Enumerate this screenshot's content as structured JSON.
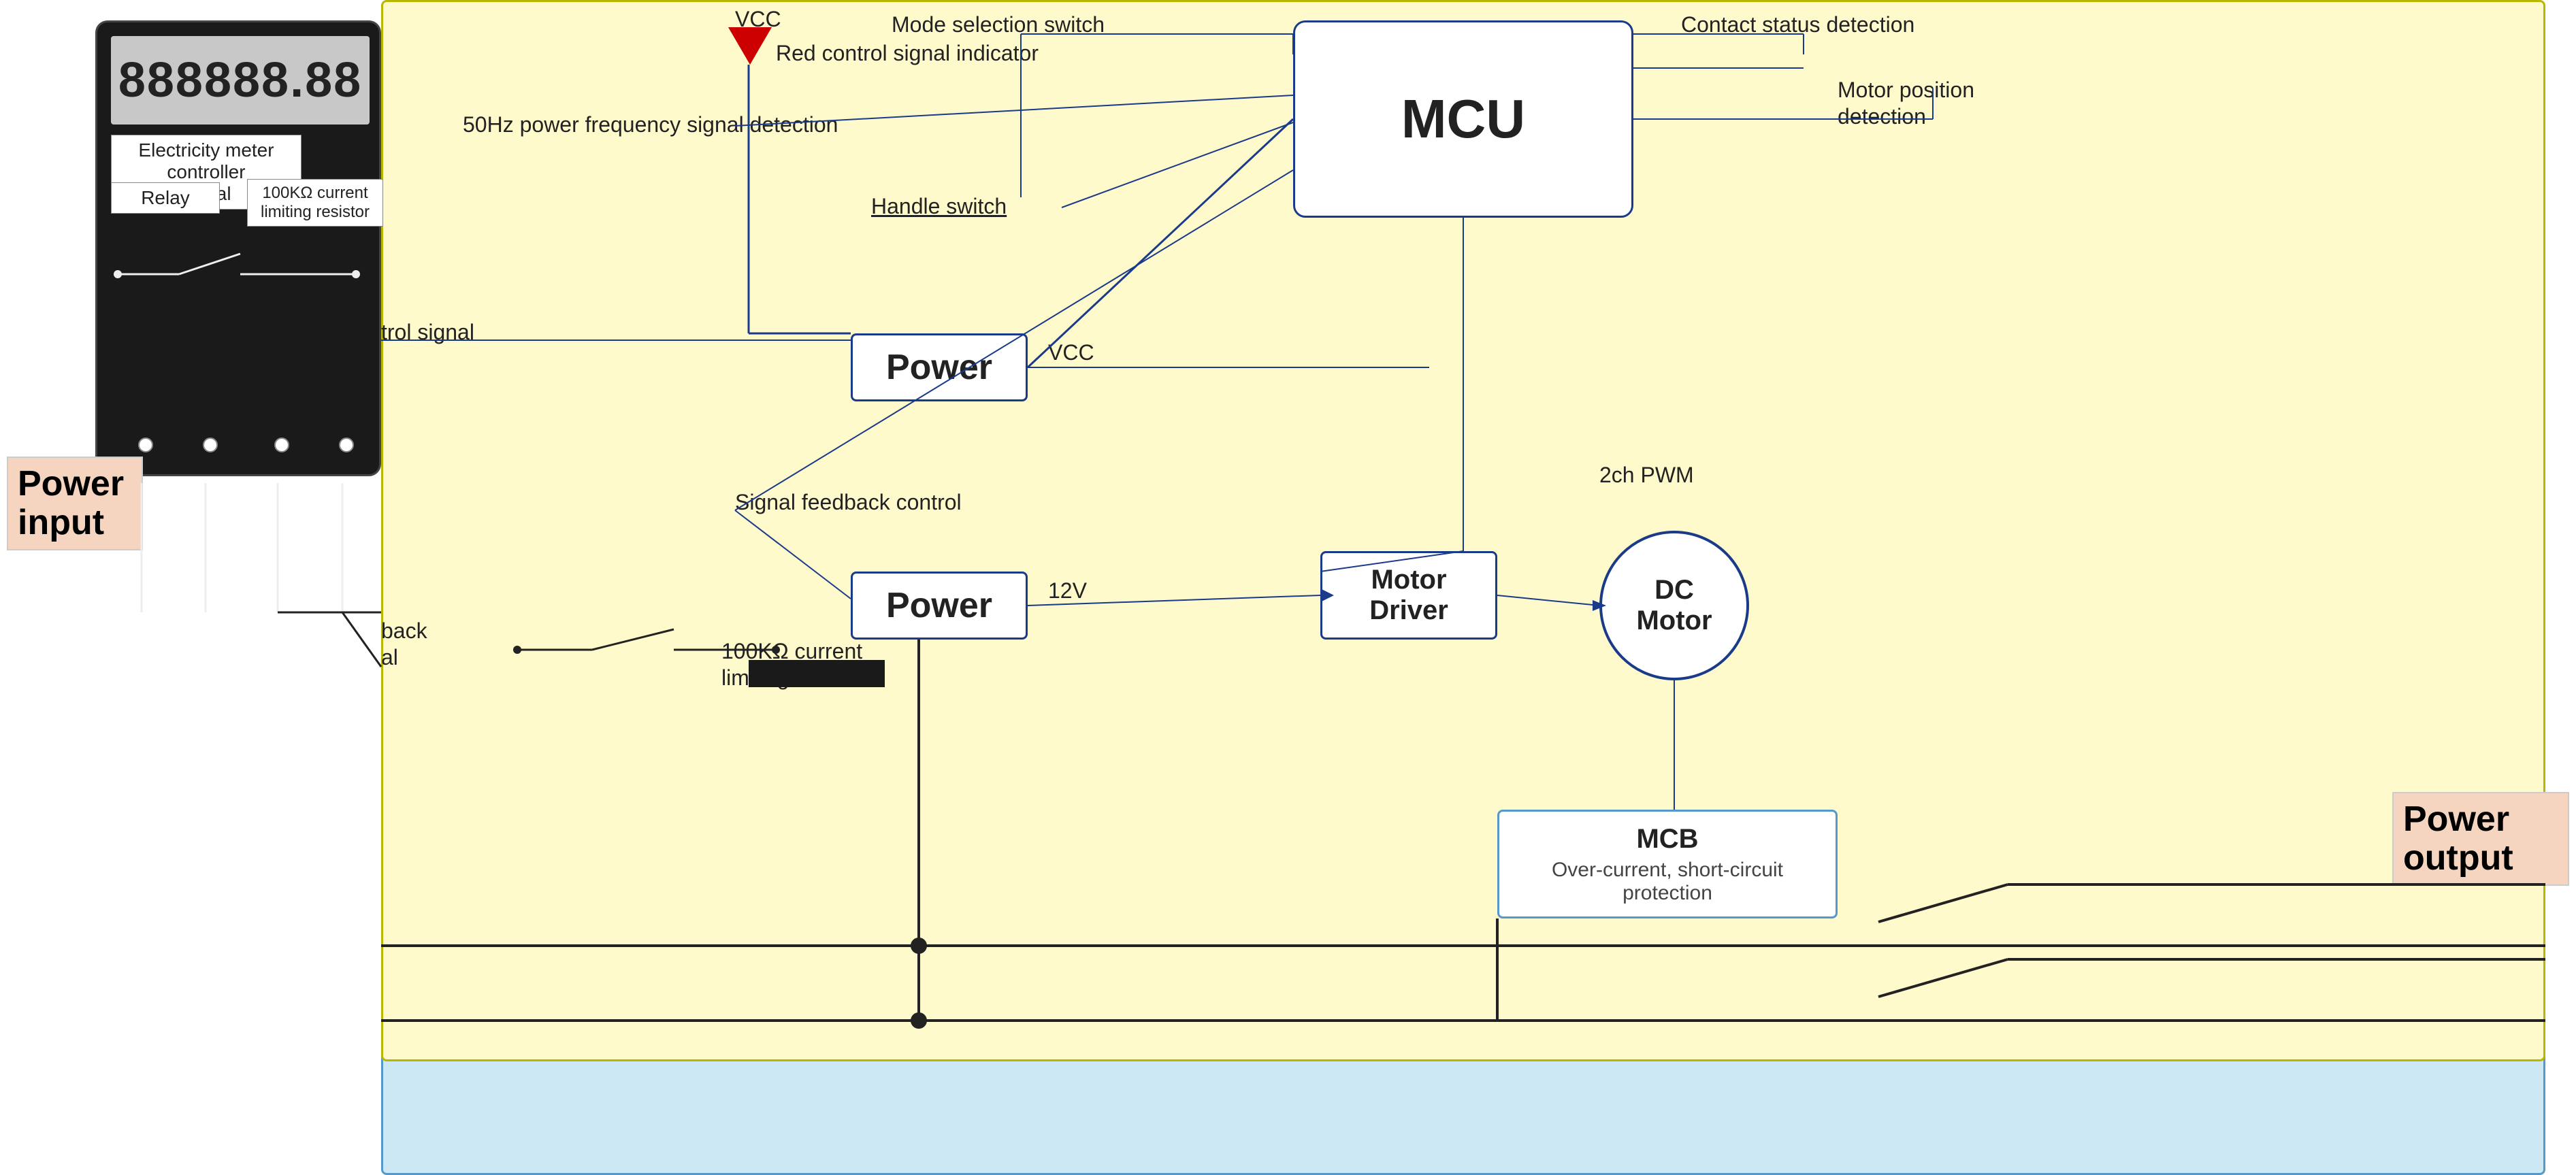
{
  "power_input": {
    "label": "Power\ninput"
  },
  "power_output": {
    "label": "Power\noutput"
  },
  "meter": {
    "display": "888888.88",
    "controller_label": "Electricity meter controller\nsignal",
    "relay_label": "Relay",
    "resistor_label": "100KΩ current\nlimiting resistor"
  },
  "circuit": {
    "vcc_top": "VCC",
    "red_indicator_label": "Red control signal indicator",
    "mode_switch_label": "Mode selection switch",
    "contact_detection_label": "Contact status detection",
    "motor_position_label": "Motor position\ndetection",
    "freq_signal_label": "50Hz power frequency signal detection",
    "handle_switch_label": "Handle switch",
    "mcu_label": "MCU",
    "power_top_label": "Power",
    "vcc_right": "VCC",
    "control_signal_label": "trol signal",
    "power_bottom_label": "Power",
    "voltage_12v": "12V",
    "motor_driver_label": "Motor\nDriver",
    "dc_motor_label": "DC\nMotor",
    "signal_feedback_label": "Signal feedback control",
    "feedback_signal_label": "back\nal",
    "resistor_bottom_label": "100KΩ current\nlimiting resistor",
    "pwm_label": "2ch PWM",
    "mcb_title": "MCB",
    "mcb_subtitle": "Over-current, short-circuit protection"
  }
}
